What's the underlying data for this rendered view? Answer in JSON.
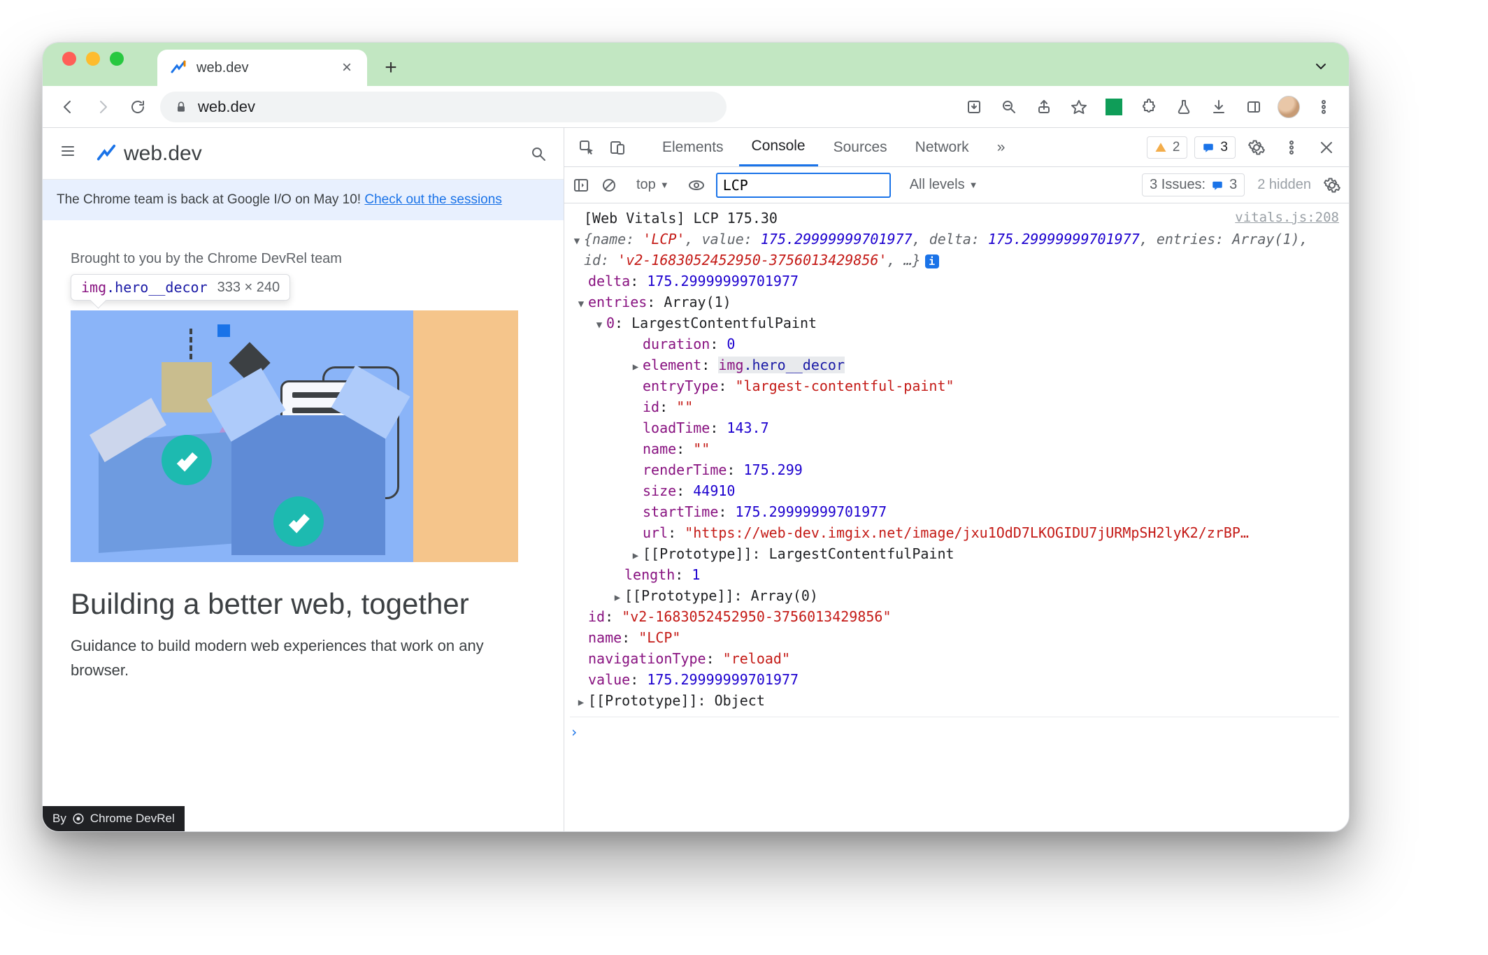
{
  "window": {
    "traffic": {
      "close": "#ff5f57",
      "min": "#febc2e",
      "max": "#28c840"
    },
    "tab": {
      "title": "web.dev"
    },
    "chevron_label": "Window menu"
  },
  "toolbar": {
    "url": "web.dev",
    "back": "Back",
    "forward": "Forward",
    "reload": "Reload",
    "icons": {
      "install": "Install",
      "zoom": "Zoom",
      "share": "Share",
      "star": "Bookmark",
      "ext": "Extension",
      "puzzle": "Extensions",
      "flask": "Experiments",
      "download": "Downloads",
      "panel": "Side panel",
      "avatar": "Profile",
      "menu": "Menu"
    }
  },
  "page": {
    "logo": "web.dev",
    "banner_text": "The Chrome team is back at Google I/O on May 10! ",
    "banner_link": "Check out the sessions",
    "subtitle": "Brought to you by the Chrome DevRel team",
    "inspect_selector_tag": "img",
    "inspect_selector_class": ".hero__decor",
    "inspect_dims": "333 × 240",
    "h1": "Building a better web, together",
    "lead": "Guidance to build modern web experiences that work on any browser.",
    "badge_prefix": "By",
    "badge_text": "Chrome DevRel"
  },
  "devtools": {
    "tabs": [
      "Elements",
      "Console",
      "Sources",
      "Network"
    ],
    "active_tab": "Console",
    "more": "»",
    "warnings": "2",
    "infos": "3",
    "filter_context": "top",
    "filter_value": "LCP",
    "levels": "All levels",
    "issues_label": "3 Issues:",
    "issues_count": "3",
    "hidden": "2 hidden",
    "source_link": "vitals.js:208",
    "log_header": "[Web Vitals] LCP 175.30",
    "obj_summary_prefix": "{name: ",
    "obj_summary_name": "'LCP'",
    "obj_summary_mid1": ", value: ",
    "obj_summary_value": "175.29999999701977",
    "obj_summary_mid2": ", delta: ",
    "obj_summary_delta": "175.29999999701977",
    "obj_summary_mid3": ", entries: Array(1), id: ",
    "obj_summary_id": "'v2-1683052452950-3756013429856'",
    "obj_summary_tail": ", …}",
    "props": {
      "delta": "175.29999999701977",
      "entries": "Array(1)",
      "entry0": "LargestContentfulPaint",
      "duration": "0",
      "element_label": "element",
      "element_tag": "img",
      "element_class": ".hero__decor",
      "entryType": "\"largest-contentful-paint\"",
      "id_empty": "\"\"",
      "loadTime": "143.7",
      "name_empty": "\"\"",
      "renderTime": "175.299",
      "size": "44910",
      "startTime": "175.29999999701977",
      "url": "\"https://web-dev.imgix.net/image/jxu1OdD7LKOGIDU7jURMpSH2lyK2/zrBP…",
      "proto0": "LargestContentfulPaint",
      "length": "1",
      "proto_arr": "Array(0)",
      "id": "\"v2-1683052452950-3756013429856\"",
      "name": "\"LCP\"",
      "navigationType": "\"reload\"",
      "value": "175.29999999701977",
      "proto_obj": "Object"
    }
  }
}
